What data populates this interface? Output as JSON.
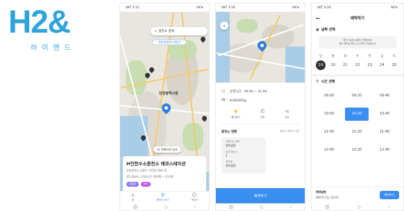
{
  "logo": {
    "text": "H2&",
    "subtitle": "하이앤드"
  },
  "status": {
    "time1": "SKT 3:15",
    "time2": "SKT 3:16",
    "time3": "SKT 3:20",
    "battery": "94%"
  },
  "screen1": {
    "search_placeholder": "충전소 검색",
    "filter_chip": "현재 위치에서 재검색",
    "map_label": "인천광역시청",
    "list_button": "목록으로 보기",
    "card": {
      "title": "H인천수소충전소 에코스테이션",
      "address": "인천광역시 남동구 고잔동 246-15",
      "hours": "25.24km | 운영시간: 09:00 ~ 21:00",
      "tags": [
        "영업중",
        "예약"
      ]
    },
    "tabs": [
      {
        "label": "홈",
        "icon": "home-icon"
      },
      {
        "label": "충전소 찾기",
        "icon": "location-icon"
      },
      {
        "label": "내정보",
        "icon": "person-icon"
      }
    ]
  },
  "screen2": {
    "hours": "운영시간 : 09:00 ~ 21:00",
    "price": "8,800원/kg",
    "actions": [
      {
        "label": "즐겨찾기",
        "icon": "star-icon"
      },
      {
        "label": "전화",
        "icon": "phone-icon"
      },
      {
        "label": "공유",
        "icon": "share-icon"
      }
    ],
    "status_title": "충전소 현황",
    "status_time": "충전소 데이터 기준",
    "status_items": [
      {
        "label": "이용가능 여부",
        "value": "정보없음"
      },
      {
        "label": "대기차량 수",
        "value": "1"
      },
      {
        "label": "재고량",
        "value": "정보없음"
      }
    ],
    "reserve_button": "예약하기"
  },
  "screen3": {
    "title": "예약하기",
    "date_section": "날짜 선택",
    "notice_l1": "예약 가능한 날짜를 선택하세요",
    "notice_l2": "충전 예약은 최대 1시간까지 가능합니다",
    "weekdays": [
      "일",
      "월",
      "화",
      "수",
      "목",
      "금",
      "토"
    ],
    "dates": [
      "19",
      "20",
      "21",
      "22",
      "23",
      "24",
      "25"
    ],
    "selected_date": "19",
    "time_section": "시간 선택",
    "slots": [
      "09:00",
      "09:20",
      "09:40",
      "10:00",
      "10:20",
      "10:40",
      "11:00",
      "11:20",
      "11:40",
      "12:00",
      "12:20",
      "12:40"
    ],
    "selected_slot": "10:20",
    "footer_label": "예약날짜",
    "footer_value": "09/19 (목) 10:20",
    "confirm_button": "예약하기"
  },
  "nav": {
    "menu": "|||",
    "home": "○",
    "back": "‹"
  },
  "colors": {
    "accent": "#3a8ef0",
    "logo": "#2ea3dc"
  }
}
